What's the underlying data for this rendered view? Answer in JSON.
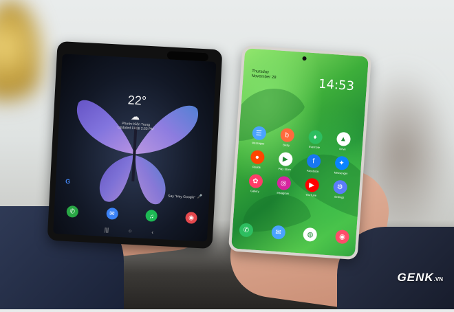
{
  "fold_phone": {
    "temperature": "22°",
    "weather_icon": "☁",
    "location_line_1": "Phước Kiên Trung",
    "location_line_2": "Updated 11/28 2:53 PM",
    "assistant_prompt": "Say \"Hey Google\"",
    "dock_apps": [
      {
        "name": "phone",
        "glyph": "✆",
        "color": "#29a745"
      },
      {
        "name": "messages",
        "glyph": "✉",
        "color": "#3b82f6"
      },
      {
        "name": "spotify",
        "glyph": "♫",
        "color": "#1db954"
      },
      {
        "name": "camera",
        "glyph": "◉",
        "color": "#e5484d"
      }
    ],
    "nav_glyphs": [
      "|||",
      "○",
      "‹"
    ]
  },
  "note_phone": {
    "day": "Thursday",
    "date": "November 28",
    "time": "14:53",
    "apps": [
      {
        "label": "Messages",
        "glyph": "☰",
        "color": "#4aa3ff"
      },
      {
        "label": "Bixby",
        "glyph": "b",
        "color": "#ff6a3d"
      },
      {
        "label": "Evernote",
        "glyph": "♦",
        "color": "#2dbe60"
      },
      {
        "label": "Drive",
        "glyph": "▲",
        "color": "#ffffff"
      },
      {
        "label": "Reddit",
        "glyph": "●",
        "color": "#ff4500"
      },
      {
        "label": "Play Store",
        "glyph": "▶",
        "color": "#ffffff"
      },
      {
        "label": "Facebook",
        "glyph": "f",
        "color": "#1877f2"
      },
      {
        "label": "Messenger",
        "glyph": "✦",
        "color": "#0a84ff"
      },
      {
        "label": "Gallery",
        "glyph": "✿",
        "color": "#ff3d68"
      },
      {
        "label": "Instagram",
        "glyph": "◎",
        "color": "#d6249f"
      },
      {
        "label": "YouTube",
        "glyph": "▶",
        "color": "#ff0000"
      },
      {
        "label": "Settings",
        "glyph": "⚙",
        "color": "#5b7cfa"
      }
    ],
    "dock_apps": [
      {
        "name": "phone",
        "glyph": "✆",
        "color": "#2dbe60"
      },
      {
        "name": "messages",
        "glyph": "✉",
        "color": "#4aa3ff"
      },
      {
        "name": "chrome",
        "glyph": "◍",
        "color": "#ffffff"
      },
      {
        "name": "camera",
        "glyph": "◉",
        "color": "#ff4d6a"
      }
    ]
  },
  "watermark": {
    "brand": "GENK",
    "suffix": ".VN"
  }
}
